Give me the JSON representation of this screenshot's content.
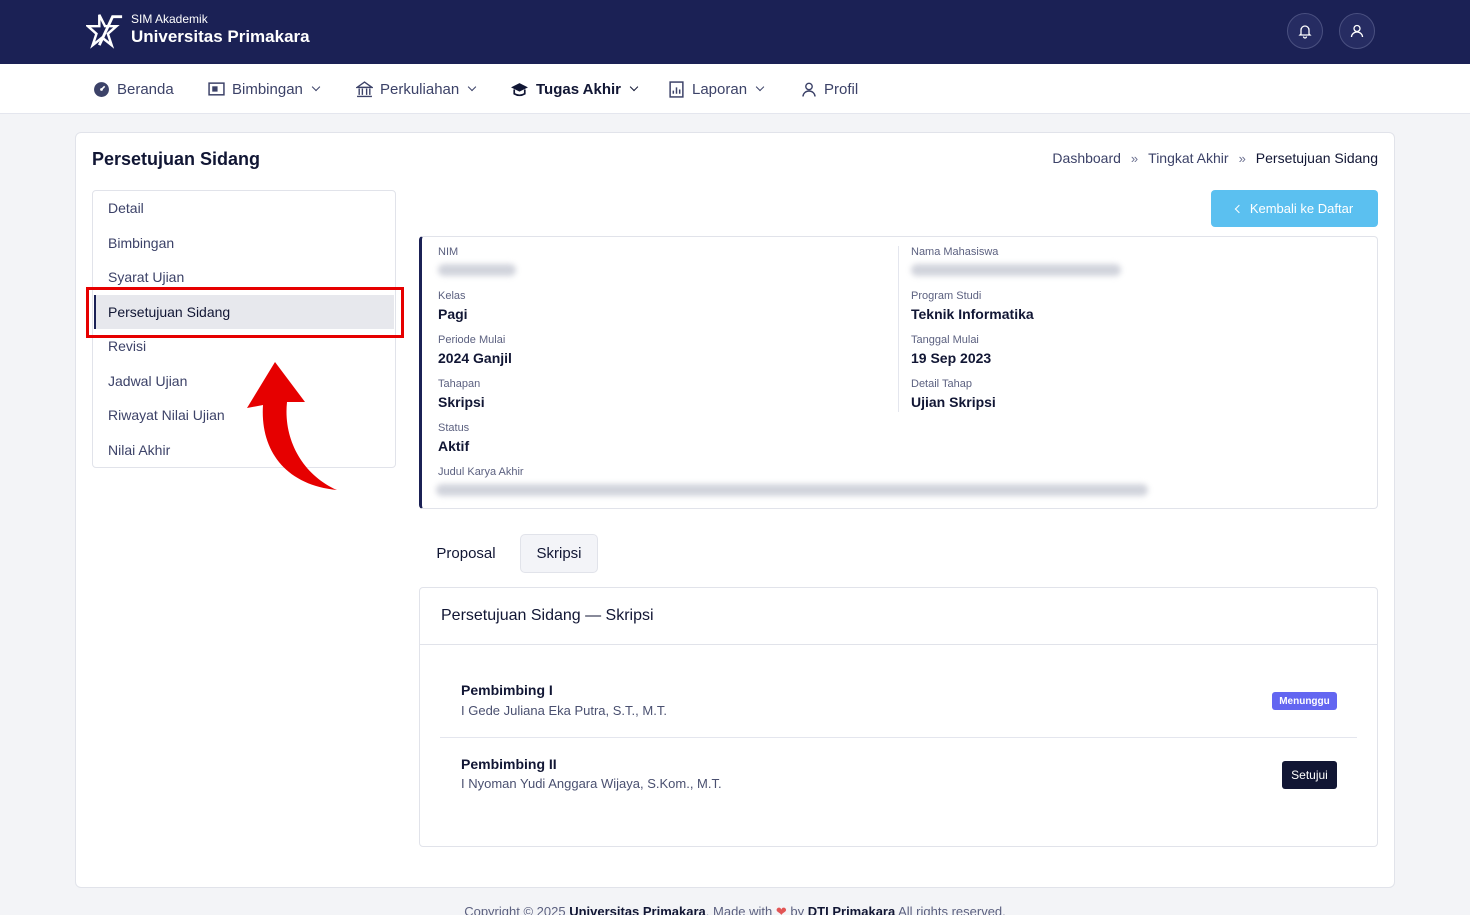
{
  "header": {
    "app_small": "SIM Akademik",
    "app_big": "Universitas Primakara",
    "notification_icon": "bell-icon",
    "profile_icon": "user-icon"
  },
  "nav": {
    "items": [
      {
        "label": "Beranda",
        "icon": "dashboard-icon",
        "dropdown": false
      },
      {
        "label": "Bimbingan",
        "icon": "board-icon",
        "dropdown": true
      },
      {
        "label": "Perkuliahan",
        "icon": "building-icon",
        "dropdown": true
      },
      {
        "label": "Tugas Akhir",
        "icon": "graduation-cap-icon",
        "dropdown": true,
        "active": true
      },
      {
        "label": "Laporan",
        "icon": "report-icon",
        "dropdown": true
      },
      {
        "label": "Profil",
        "icon": "user-icon",
        "dropdown": false
      }
    ]
  },
  "page": {
    "title": "Persetujuan Sidang",
    "breadcrumb": [
      "Dashboard",
      "Tingkat Akhir",
      "Persetujuan Sidang"
    ],
    "breadcrumb_sep": "»"
  },
  "side_menu": {
    "items": [
      "Detail",
      "Bimbingan",
      "Syarat Ujian",
      "Persetujuan Sidang",
      "Revisi",
      "Jadwal Ujian",
      "Riwayat Nilai Ujian",
      "Nilai Akhir"
    ],
    "active": "Persetujuan Sidang"
  },
  "back_button": "Kembali ke Daftar",
  "info": {
    "nim_label": "NIM",
    "nama_label": "Nama Mahasiswa",
    "kelas_label": "Kelas",
    "kelas": "Pagi",
    "prodi_label": "Program Studi",
    "prodi": "Teknik Informatika",
    "periode_label": "Periode Mulai",
    "periode": "2024 Ganjil",
    "tanggal_label": "Tanggal Mulai",
    "tanggal": "19 Sep 2023",
    "tahapan_label": "Tahapan",
    "tahapan": "Skripsi",
    "detail_tahap_label": "Detail Tahap",
    "detail_tahap": "Ujian Skripsi",
    "status_label": "Status",
    "status": "Aktif",
    "judul_label": "Judul Karya Akhir"
  },
  "tabs": [
    "Proposal",
    "Skripsi"
  ],
  "active_tab": "Skripsi",
  "approval": {
    "title": "Persetujuan Sidang — Skripsi",
    "rows": [
      {
        "role": "Pembimbing I",
        "name": "I Gede Juliana Eka Putra, S.T., M.T.",
        "status": "Menunggu"
      },
      {
        "role": "Pembimbing II",
        "name": "I Nyoman Yudi Anggara Wijaya, S.Kom., M.T.",
        "action": "Setujui"
      }
    ]
  },
  "colors": {
    "header_bg": "#1b2155",
    "accent_button": "#5bc0f0",
    "badge": "#6366f1",
    "highlight": "#e60000"
  },
  "footer": {
    "prefix": "Copyright © 2025",
    "org": "Universitas Primakara",
    "made_with": "Made with",
    "by": "by",
    "team": "DTI Primakara",
    "suffix": "All rights reserved."
  }
}
